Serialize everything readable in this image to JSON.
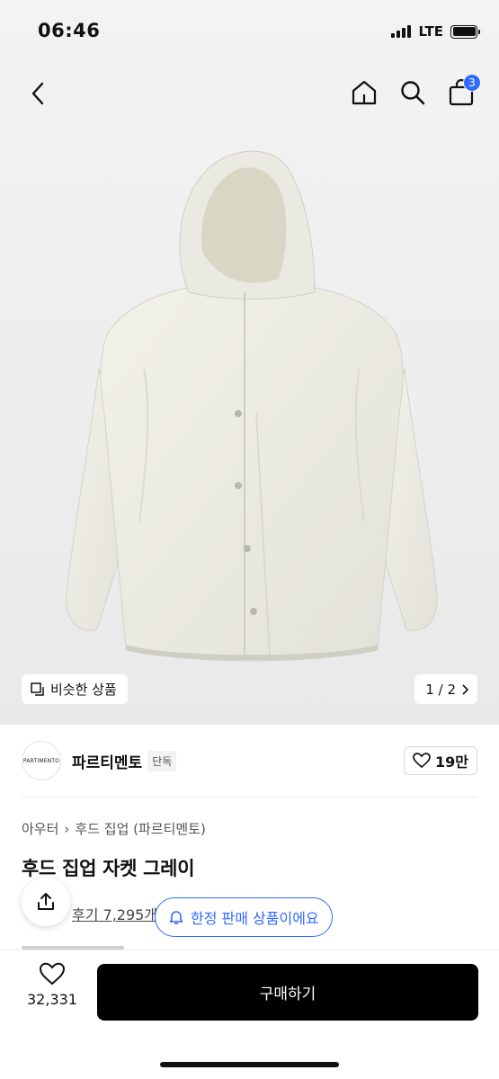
{
  "status": {
    "time": "06:46",
    "network": "LTE"
  },
  "nav": {
    "cart_count": "3"
  },
  "gallery": {
    "similar_label": "비슷한 상품",
    "pager": "1 / 2"
  },
  "brand": {
    "logo_text": "PARTIMENTO",
    "name": "파르티멘토",
    "tag": "단독",
    "likes": "19만"
  },
  "product": {
    "breadcrumb": [
      "아우터",
      "후드 집업 (파르티멘토)"
    ],
    "title": "후드 집업 자켓 그레이",
    "review_link": "후기 7,295개",
    "limited_notice": "한정 판매 상품이에요"
  },
  "footer": {
    "wish_count": "32,331",
    "buy_label": "구매하기"
  },
  "colors": {
    "accent": "#2f6bff",
    "buy_button": "#000000",
    "jacket": "#ecebe4"
  }
}
